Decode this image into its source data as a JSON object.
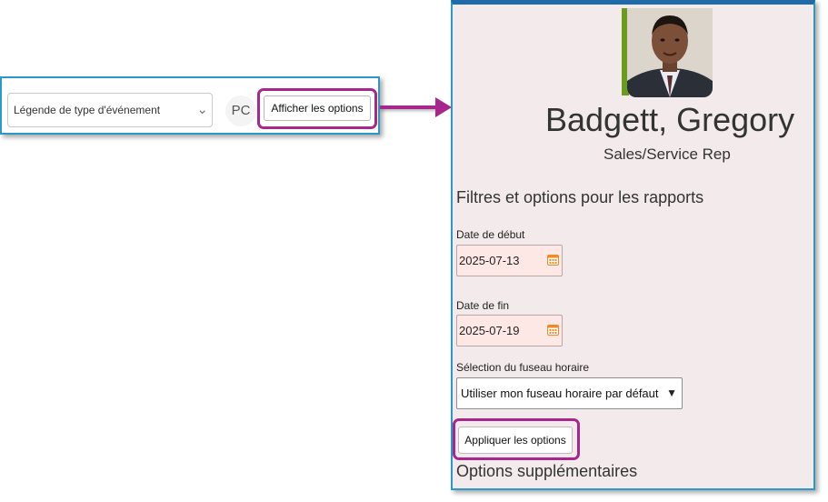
{
  "toolbar": {
    "legend_select": {
      "value": "Légende de type d'événement",
      "icon": "chevron-down-icon"
    },
    "avatar_initials": "PC",
    "show_options_label": "Afficher les options"
  },
  "panel": {
    "employee": {
      "name": "Badgett, Gregory",
      "title": "Sales/Service Rep"
    },
    "filters_title": "Filtres et options pour les rapports",
    "start_date": {
      "label": "Date de début",
      "value": "2025-07-13"
    },
    "end_date": {
      "label": "Date de fin",
      "value": "2025-07-19"
    },
    "timezone": {
      "label": "Sélection du fuseau horaire",
      "value": "Utiliser mon fuseau horaire par défaut"
    },
    "apply_label": "Appliquer les options",
    "more_options_title": "Options supplémentaires"
  },
  "colors": {
    "highlight": "#a7278c",
    "panel_border": "#2a98c8",
    "panel_top_border": "#1f6aa8",
    "panel_bg": "#f3ebeb",
    "date_input_bg": "#fde8e6",
    "calendar_icon": "#f08a24",
    "photo_accent": "#6a9b1e"
  }
}
